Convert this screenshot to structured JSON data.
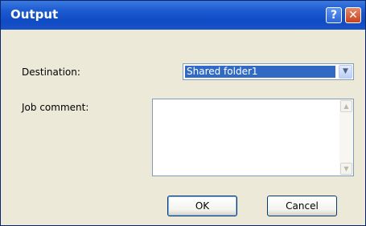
{
  "window": {
    "title": "Output",
    "help_icon": "?",
    "close_icon": "✕"
  },
  "form": {
    "destination_label": "Destination:",
    "destination_value": "Shared folder1",
    "job_comment_label": "Job comment:",
    "job_comment_value": ""
  },
  "buttons": {
    "ok_label": "OK",
    "cancel_label": "Cancel"
  },
  "colors": {
    "titlebar": "#0f4bc4",
    "selection": "#316ac5",
    "dialog_bg": "#ece9d8",
    "close_button": "#c6421e"
  }
}
